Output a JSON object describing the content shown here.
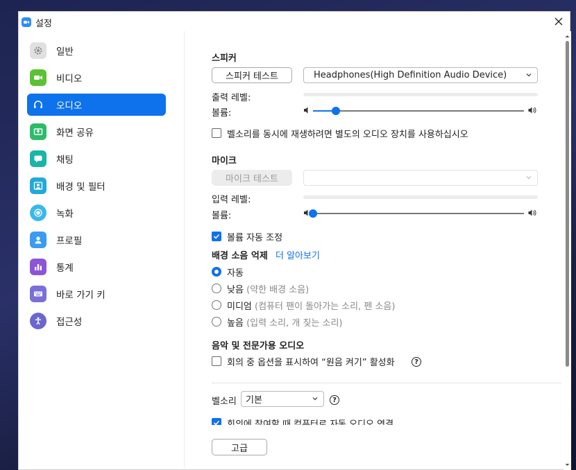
{
  "window": {
    "title": "설정",
    "accent": "#0e72ed"
  },
  "sidebar": {
    "items": [
      {
        "label": "일반",
        "icon": "gear-icon",
        "color": "#e0e0e0"
      },
      {
        "label": "비디오",
        "icon": "video-camera-icon",
        "color": "#5bc236"
      },
      {
        "label": "오디오",
        "icon": "headphones-icon",
        "color": "#0e72ed",
        "active": true
      },
      {
        "label": "화면 공유",
        "icon": "share-screen-icon",
        "color": "#2dbb6a"
      },
      {
        "label": "채팅",
        "icon": "chat-icon",
        "color": "#18b5a8"
      },
      {
        "label": "배경 및 필터",
        "icon": "background-icon",
        "color": "#23a9d8"
      },
      {
        "label": "녹화",
        "icon": "record-icon",
        "color": "#3bb8ea"
      },
      {
        "label": "프로필",
        "icon": "profile-icon",
        "color": "#3b9bf0"
      },
      {
        "label": "통계",
        "icon": "statistics-icon",
        "color": "#8b55d9"
      },
      {
        "label": "바로 가기 키",
        "icon": "keyboard-icon",
        "color": "#7a6fd8"
      },
      {
        "label": "접근성",
        "icon": "accessibility-icon",
        "color": "#6b67cf"
      }
    ]
  },
  "speaker": {
    "title": "스피커",
    "test_button": "스피커 테스트",
    "device": "Headphones(High Definition Audio Device)",
    "output_level_label": "출력 레벨:",
    "output_level": 0,
    "volume_label": "볼륨:",
    "volume": 0.11
  },
  "ringtone_separate": {
    "label": "벨소리를 동시에 재생하려면 별도의 오디오 장치를 사용하십시오",
    "checked": false
  },
  "mic": {
    "title": "마이크",
    "test_button": "마이크 테스트",
    "device": "",
    "input_level_label": "입력 레벨:",
    "input_level": 0,
    "volume_label": "볼륨:",
    "volume": 0.0
  },
  "auto_volume": {
    "label": "볼륨 자동 조정",
    "checked": true
  },
  "noise": {
    "title": "배경 소음 억제",
    "learn_more": "더 알아보기",
    "options": [
      {
        "label": "자동",
        "hint": "",
        "checked": true
      },
      {
        "label": "낮음",
        "hint": "(약한 배경 소음)",
        "checked": false
      },
      {
        "label": "미디엄",
        "hint": "(컴퓨터 팬이 돌아가는 소리, 펜 소음)",
        "checked": false
      },
      {
        "label": "높음",
        "hint": "(입력 소리, 개 짖는 소리)",
        "checked": false
      }
    ]
  },
  "music": {
    "title": "음악 및 전문가용 오디오",
    "original_sound_label": "회의 중 옵션을 표시하여 “원음 켜기” 활성화",
    "checked": false
  },
  "ringtone": {
    "label": "벨소리",
    "value": "기본"
  },
  "auto_join": {
    "label": "회의에 참여할 때 컴퓨터로 자동 오디오 연결",
    "checked": true
  },
  "advanced_button": "고급"
}
